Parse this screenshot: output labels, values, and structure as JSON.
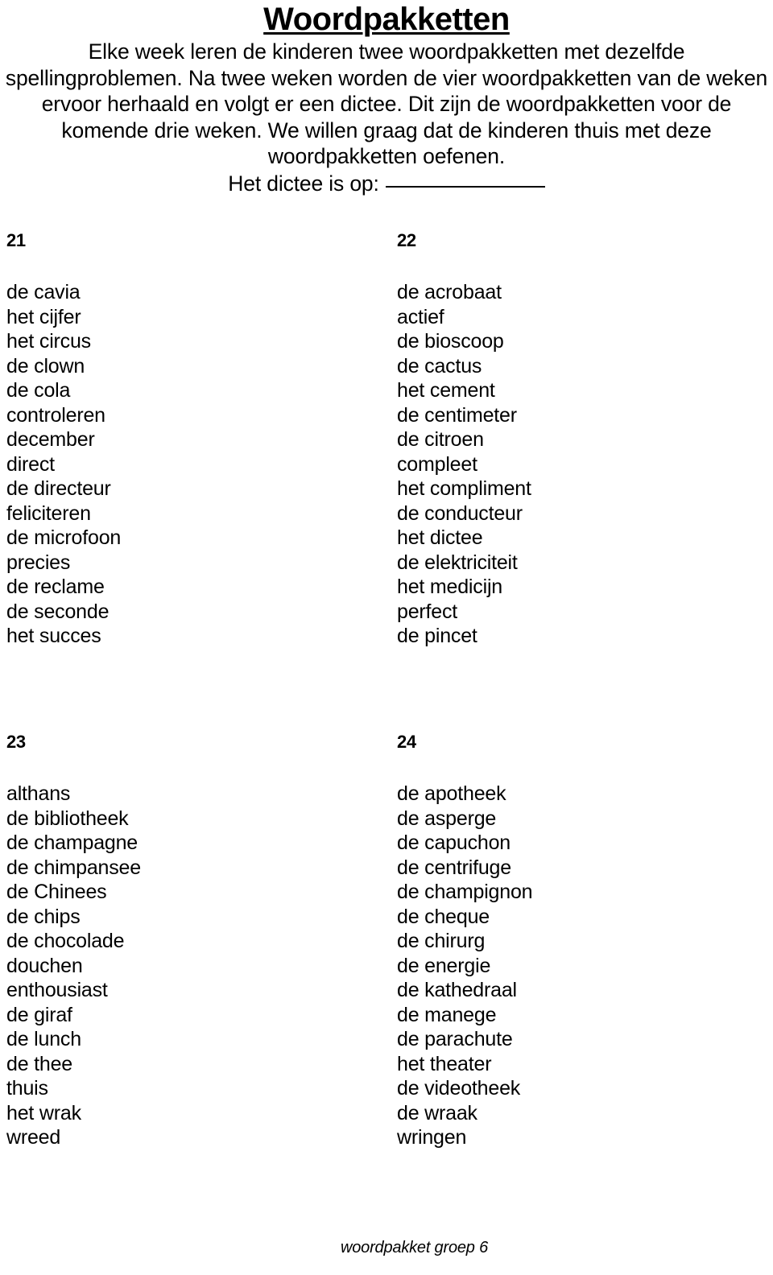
{
  "header": {
    "title": "Woordpakketten",
    "intro_lines": [
      "Elke week leren de kinderen twee woordpakketten met dezelfde",
      "spellingproblemen. Na twee weken worden de vier woordpakketten van de",
      "weken ervoor herhaald en volgt er een dictee. Dit zijn de woordpakketten",
      "voor de komende drie weken. We willen graag dat de kinderen thuis met",
      "deze woordpakketten oefenen."
    ],
    "intro_paragraph": "Elke week leren de kinderen twee woordpakketten met dezelfde spellingproblemen. Na twee weken worden de vier woordpakketten van de weken ervoor herhaald en volgt er een dictee. Dit zijn de woordpakketten voor de komende drie weken. We willen graag dat de kinderen thuis met deze woordpakketten oefenen.",
    "dictee_label": "Het dictee is op:",
    "dictee_value": ""
  },
  "packets": [
    {
      "number": "21",
      "words": [
        "de cavia",
        "het cijfer",
        "het circus",
        "de clown",
        "de cola",
        "controleren",
        "december",
        "direct",
        "de directeur",
        "feliciteren",
        "de microfoon",
        "precies",
        "de reclame",
        "de seconde",
        "het succes"
      ]
    },
    {
      "number": "22",
      "words": [
        "de acrobaat",
        "actief",
        "de bioscoop",
        "de cactus",
        "het cement",
        "de centimeter",
        "de citroen",
        "compleet",
        "het compliment",
        "de conducteur",
        "het dictee",
        "de elektriciteit",
        "het medicijn",
        "perfect",
        "de pincet"
      ]
    },
    {
      "number": "23",
      "words": [
        "althans",
        "de bibliotheek",
        "de champagne",
        "de chimpansee",
        "de Chinees",
        "de chips",
        "de chocolade",
        "douchen",
        "enthousiast",
        "de giraf",
        "de lunch",
        "de thee",
        "thuis",
        "het wrak",
        "wreed"
      ]
    },
    {
      "number": "24",
      "words": [
        "de apotheek",
        "de asperge",
        "de capuchon",
        "de centrifuge",
        "de champignon",
        "de cheque",
        "de chirurg",
        "de energie",
        "de kathedraal",
        "de manege",
        "de parachute",
        "het theater",
        "de videotheek",
        "de wraak",
        "wringen"
      ]
    }
  ],
  "footer": {
    "text": "woordpakket groep 6"
  },
  "colors": {
    "text": "#000000",
    "background": "#ffffff"
  }
}
